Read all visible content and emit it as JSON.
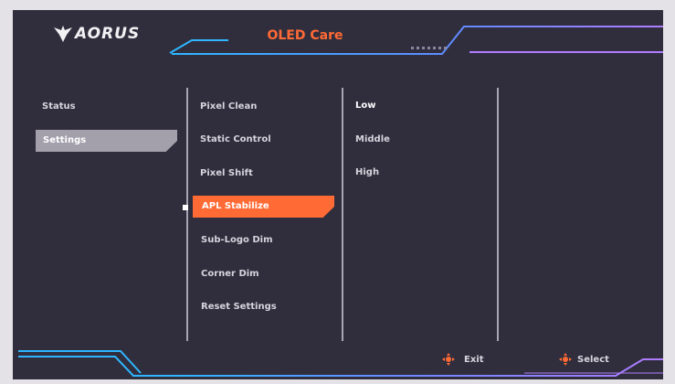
{
  "app": {
    "logo_text": "AORUS",
    "title": "OLED Care"
  },
  "left_menu": {
    "items": [
      {
        "label": "Status"
      },
      {
        "label": "Settings",
        "selected": true
      }
    ]
  },
  "sub_menu": {
    "items": [
      {
        "label": "Pixel Clean"
      },
      {
        "label": "Static Control"
      },
      {
        "label": "Pixel Shift"
      },
      {
        "label": "APL Stabilize",
        "selected": true
      },
      {
        "label": "Sub-Logo Dim"
      },
      {
        "label": "Corner Dim"
      },
      {
        "label": "Reset Settings"
      }
    ]
  },
  "values": {
    "items": [
      {
        "label": "Low",
        "highlighted": true
      },
      {
        "label": "Middle"
      },
      {
        "label": "High"
      }
    ]
  },
  "footer": {
    "exit_label": "Exit",
    "select_label": "Select"
  },
  "colors": {
    "accent": "#ff6a35",
    "cyan_line": "#2fb6ff",
    "purple_line": "#b07cff",
    "background": "#302e3d",
    "selected_gray": "#a3a0ac"
  },
  "icons": {
    "logo": "aorus-eagle-icon",
    "exit": "joystick-icon",
    "select": "joystick-icon"
  }
}
